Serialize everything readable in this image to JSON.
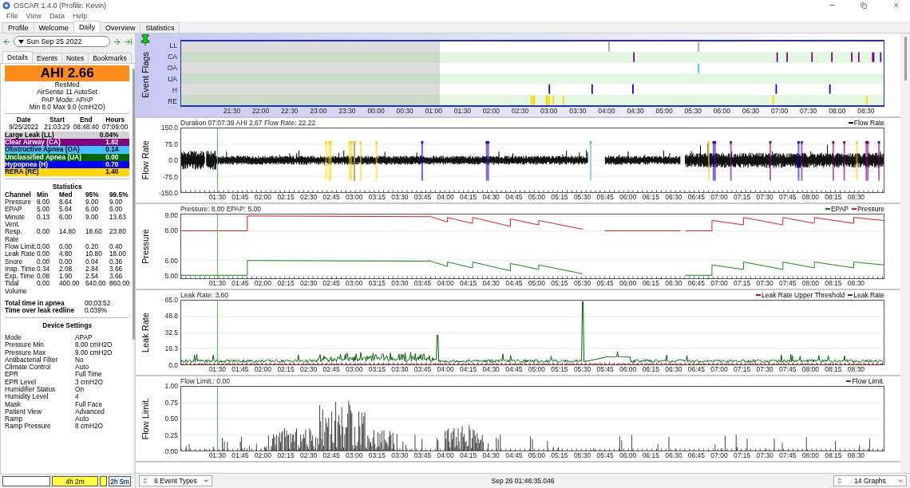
{
  "window": {
    "title": "OSCAR 1.4.0 (Profile: Kevin)"
  },
  "menu": [
    "File",
    "View",
    "Data",
    "Help"
  ],
  "tabs": [
    {
      "label": "Profile",
      "selected": false
    },
    {
      "label": "Welcome",
      "selected": false
    },
    {
      "label": "Daily",
      "selected": true
    },
    {
      "label": "Overview",
      "selected": false
    },
    {
      "label": "Statistics",
      "selected": false
    }
  ],
  "date_nav": {
    "date": "Sun Sep 25 2022"
  },
  "detail_tabs": [
    {
      "label": "Details",
      "selected": true
    },
    {
      "label": "Events",
      "selected": false
    },
    {
      "label": "Notes",
      "selected": false
    },
    {
      "label": "Bookmarks",
      "selected": false
    }
  ],
  "summary": {
    "ahi": "AHI 2.66",
    "lines": [
      "ResMed",
      "AirSense 11 AutoSet",
      "PAP Mode: APAP",
      "Min 8.0 Max 9.0 (cmH2O)"
    ]
  },
  "session": {
    "columns": [
      "Date",
      "Start",
      "End",
      "Hours"
    ],
    "values": [
      "9/25/2022",
      "21:03:29",
      "08:48:40",
      "07:09:00"
    ]
  },
  "indices": [
    {
      "label": "Large Leak (LL)",
      "value": "0.04%",
      "color": "#d3d3d3"
    },
    {
      "label": "Clear Airway (CA)",
      "value": "1.82",
      "color": "#800080"
    },
    {
      "label": "Obstructive Apnea (OA)",
      "value": "0.14",
      "color": "#40c0ff"
    },
    {
      "label": "Unclassified Apnea (UA)",
      "value": "0.00",
      "color": "#006400"
    },
    {
      "label": "Hypopnea (H)",
      "value": "0.70",
      "color": "#0000ff"
    },
    {
      "label": "RERA (RE)",
      "value": "1.40",
      "color": "#ffd700"
    }
  ],
  "statistics": {
    "title": "Statistics",
    "columns": [
      "Channel",
      "Min",
      "Med",
      "95%",
      "99.5%"
    ],
    "rows": [
      [
        "Pressure",
        "8.00",
        "8.64",
        "9.00",
        "9.00"
      ],
      [
        "EPAP",
        "5.00",
        "5.64",
        "6.00",
        "6.00"
      ],
      [
        "Minute Vent.",
        "0.13",
        "6.00",
        "9.00",
        "13.63"
      ],
      [
        "Resp. Rate",
        "0.00",
        "14.80",
        "18.60",
        "23.80"
      ],
      [
        "Flow Limit.",
        "0.00",
        "0.00",
        "0.20",
        "0.40"
      ],
      [
        "Leak Rate",
        "0.00",
        "4.80",
        "10.80",
        "18.00"
      ],
      [
        "Snore",
        "0.00",
        "0.00",
        "0.04",
        "0.36"
      ],
      [
        "Insp. Time",
        "0.34",
        "2.08",
        "2.84",
        "3.66"
      ],
      [
        "Exp. Time",
        "0.08",
        "1.90",
        "2.54",
        "3.66"
      ],
      [
        "Tidal Volume",
        "0.00",
        "400.00",
        "640.00",
        "860.00"
      ]
    ]
  },
  "totals": [
    {
      "label": "Total time in apnea",
      "value": "00:03:52"
    },
    {
      "label": "Time over leak redline",
      "value": "0.039%"
    }
  ],
  "device_settings": {
    "title": "Device Settings",
    "rows": [
      [
        "Mode",
        "APAP"
      ],
      [
        "Pressure Min",
        "8.00 cmH2O"
      ],
      [
        "Pressure Max",
        "9.00 cmH2O"
      ],
      [
        "Antibacterial Filter",
        "No"
      ],
      [
        "Climate Control",
        "Auto"
      ],
      [
        "EPR",
        "Full Time"
      ],
      [
        "EPR Level",
        "3 cmH2O"
      ],
      [
        "Humidifier Status",
        "On"
      ],
      [
        "Humidity Level",
        "4"
      ],
      [
        "Mask",
        "Full Face"
      ],
      [
        "Patient View",
        "Advanced"
      ],
      [
        "Ramp",
        "Auto"
      ],
      [
        "Ramp Pressure",
        "8 cmH2O"
      ]
    ]
  },
  "time_bar": {
    "segments": [
      "4h 2m",
      "2h 5m"
    ]
  },
  "event_flags": {
    "title": "Event Flags",
    "rows": [
      {
        "label": "LL"
      },
      {
        "label": "CA"
      },
      {
        "label": "OA"
      },
      {
        "label": "UA"
      },
      {
        "label": "H"
      },
      {
        "label": "RE"
      }
    ],
    "xticks": [
      "21:30",
      "22:00",
      "22:30",
      "23:00",
      "23:30",
      "00:00",
      "00:30",
      "01:00",
      "01:30",
      "02:00",
      "02:30",
      "03:00",
      "03:30",
      "04:00",
      "04:30",
      "05:00",
      "05:30",
      "06:00",
      "06:30",
      "07:00",
      "07:30",
      "08:00",
      "08:30"
    ]
  },
  "graphs": [
    {
      "kind": "flow",
      "title": "Flow Rate",
      "info": "Duration 07:07:39 AHI 2.67 Flow Rate: 22.22",
      "legend": [
        {
          "label": "Flow Rate",
          "color": "#000000"
        }
      ],
      "yticks": [
        "150.0",
        "75.0",
        "0.0",
        "-75.0",
        "-150.0"
      ],
      "xticks": [
        "01:30",
        "01:45",
        "02:00",
        "02:15",
        "02:30",
        "02:45",
        "03:00",
        "03:15",
        "03:30",
        "03:45",
        "04:00",
        "04:15",
        "04:30",
        "04:45",
        "05:00",
        "05:15",
        "05:30",
        "05:45",
        "06:00",
        "06:15",
        "06:30",
        "06:45",
        "07:00",
        "07:15",
        "07:30",
        "07:45",
        "08:00",
        "08:15",
        "08:30"
      ]
    },
    {
      "kind": "pressure",
      "title": "Pressure",
      "info": "Pressure: 8.00 EPAP: 5.00",
      "legend": [
        {
          "label": "EPAP",
          "color": "#008000"
        },
        {
          "label": "Pressure",
          "color": "#ff0000"
        }
      ],
      "yticks": [
        "9.00",
        "8.00",
        "6.00",
        "5.00"
      ],
      "xticks": [
        "01:30",
        "01:45",
        "02:00",
        "02:15",
        "02:30",
        "02:45",
        "03:00",
        "03:15",
        "03:30",
        "03:45",
        "04:00",
        "04:15",
        "04:30",
        "04:45",
        "05:00",
        "05:15",
        "05:30",
        "05:45",
        "06:00",
        "06:15",
        "06:30",
        "06:45",
        "07:00",
        "07:15",
        "07:30",
        "07:45",
        "08:00",
        "08:15",
        "08:30"
      ]
    },
    {
      "kind": "leak",
      "title": "Leak Rate",
      "info": "Leak Rate: 3.60",
      "legend": [
        {
          "label": "Leak Rate Upper Threshold",
          "color": "#ff0000"
        },
        {
          "label": "Leak Rate",
          "color": "#006400"
        }
      ],
      "yticks": [
        "65.0",
        "48.8",
        "32.5",
        "16.3",
        "0.0"
      ],
      "xticks": [
        "01:30",
        "01:45",
        "02:00",
        "02:15",
        "02:30",
        "02:45",
        "03:00",
        "03:15",
        "03:30",
        "03:45",
        "04:00",
        "04:15",
        "04:30",
        "04:45",
        "05:00",
        "05:15",
        "05:30",
        "05:45",
        "06:00",
        "06:15",
        "06:30",
        "06:45",
        "07:00",
        "07:15",
        "07:30",
        "07:45",
        "08:00",
        "08:15",
        "08:30"
      ]
    },
    {
      "kind": "flowlimit",
      "title": "Flow Limit.",
      "info": "Flow Limit.: 0.00",
      "legend": [
        {
          "label": "Flow Limit.",
          "color": "#404040"
        }
      ],
      "yticks": [
        "1.00",
        "0.75",
        "0.50",
        "0.25",
        "0.00"
      ],
      "xticks": [
        "01:30",
        "01:45",
        "02:00",
        "02:15",
        "02:30",
        "02:45",
        "03:00",
        "03:15",
        "03:30",
        "03:45",
        "04:00",
        "04:15",
        "04:30",
        "04:45",
        "05:00",
        "05:15",
        "05:30",
        "05:45",
        "06:00",
        "06:15",
        "06:30",
        "06:45",
        "07:00",
        "07:15",
        "07:30",
        "07:45",
        "08:00",
        "08:15",
        "08:30"
      ]
    }
  ],
  "footer": {
    "event_types": "6 Event Types",
    "timestamp": "Sep 26 01:46:35.046",
    "graphs": "14 Graphs"
  }
}
